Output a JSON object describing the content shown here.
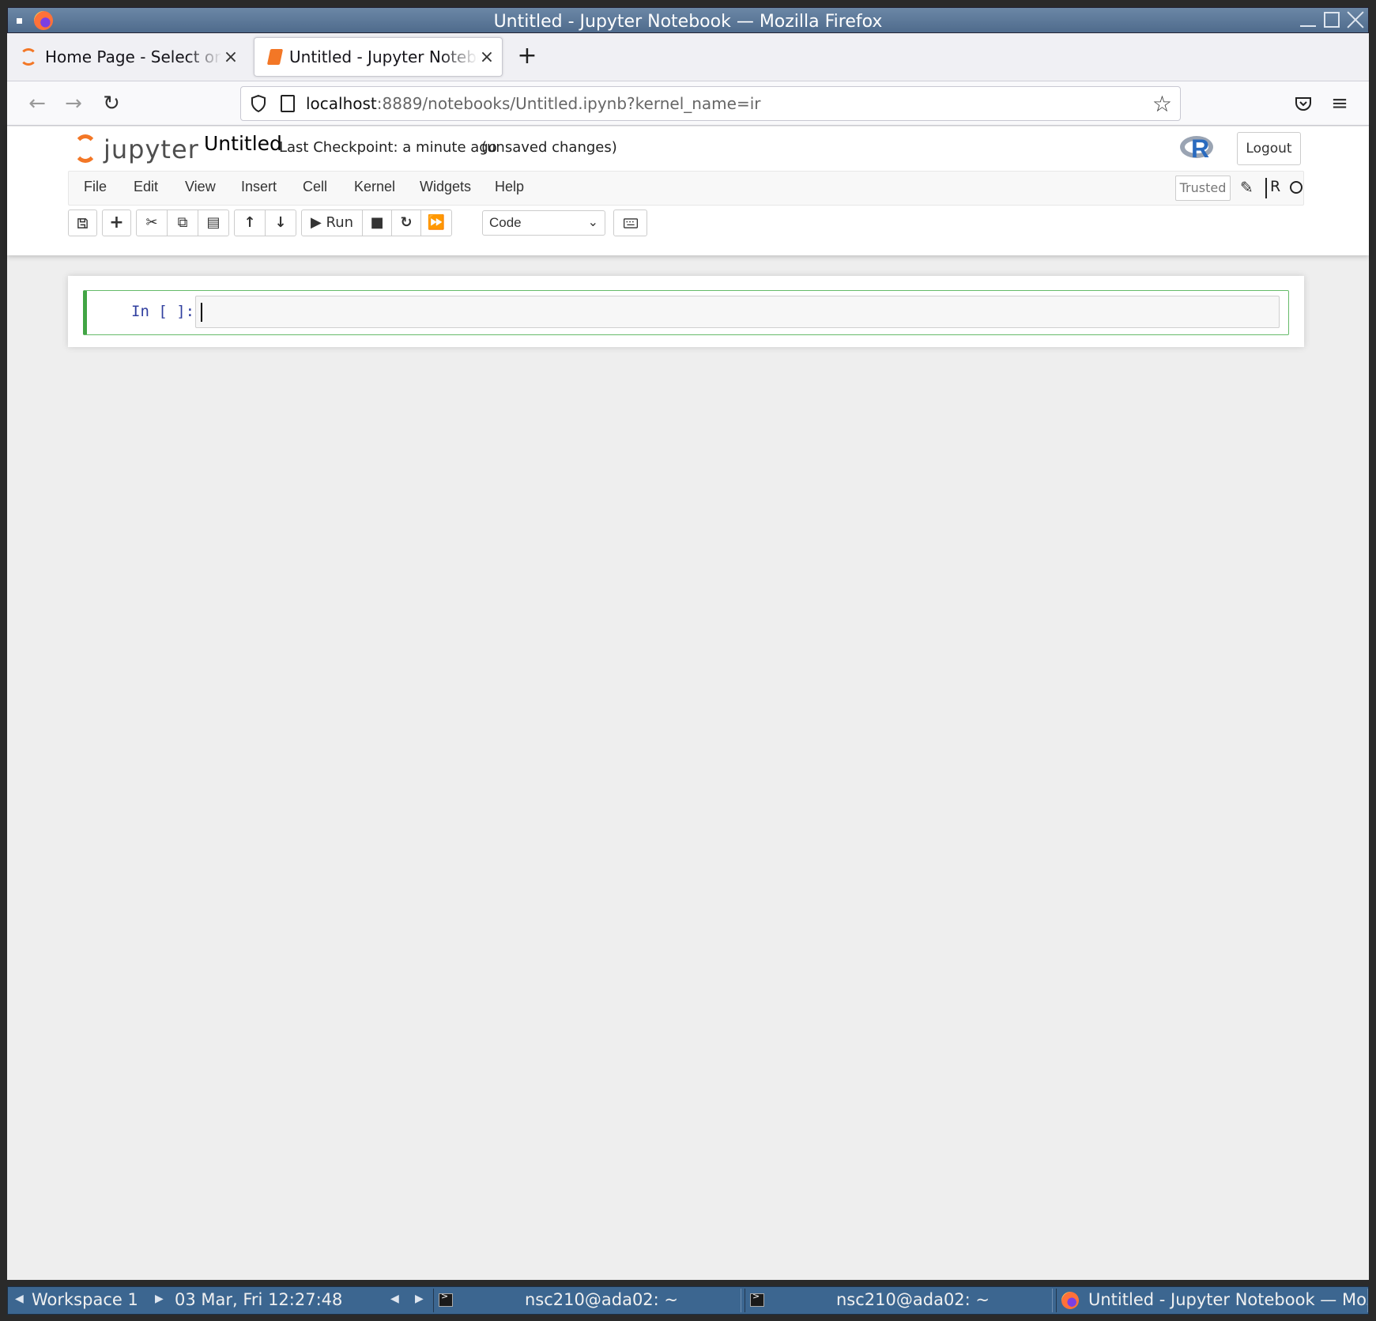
{
  "window": {
    "title": "Untitled - Jupyter Notebook — Mozilla Firefox"
  },
  "browser": {
    "tabs": [
      {
        "label": "Home Page - Select or create a notebook",
        "active": false,
        "icon": "jupyter-icon"
      },
      {
        "label": "Untitled - Jupyter Notebook",
        "active": true,
        "icon": "notebook-icon"
      }
    ],
    "new_tab": "+",
    "url_host": "localhost",
    "url_rest": ":8889/notebooks/Untitled.ipynb?kernel_name=ir"
  },
  "jupyter": {
    "logo_text": "jupyter",
    "notebook_name": "Untitled",
    "checkpoint": "Last Checkpoint: a minute ago",
    "unsaved": "(unsaved changes)",
    "logout": "Logout",
    "menu": [
      "File",
      "Edit",
      "View",
      "Insert",
      "Cell",
      "Kernel",
      "Widgets",
      "Help"
    ],
    "trusted": "Trusted",
    "kernel_name": "R",
    "run_label": "Run",
    "cell_type": "Code",
    "cell_prompt": "In [ ]:",
    "accent_color": "#f37726",
    "cell_border_color": "#42a545"
  },
  "taskbar": {
    "workspace": "Workspace 1",
    "clock": "03 Mar, Fri 12:27:48",
    "tasks": [
      {
        "label": "nsc210@ada02: ~",
        "icon": "terminal-icon"
      },
      {
        "label": "nsc210@ada02: ~",
        "icon": "terminal-icon"
      },
      {
        "label": "Untitled - Jupyter Notebook — Mozilla Firefox",
        "icon": "firefox-icon"
      }
    ]
  }
}
